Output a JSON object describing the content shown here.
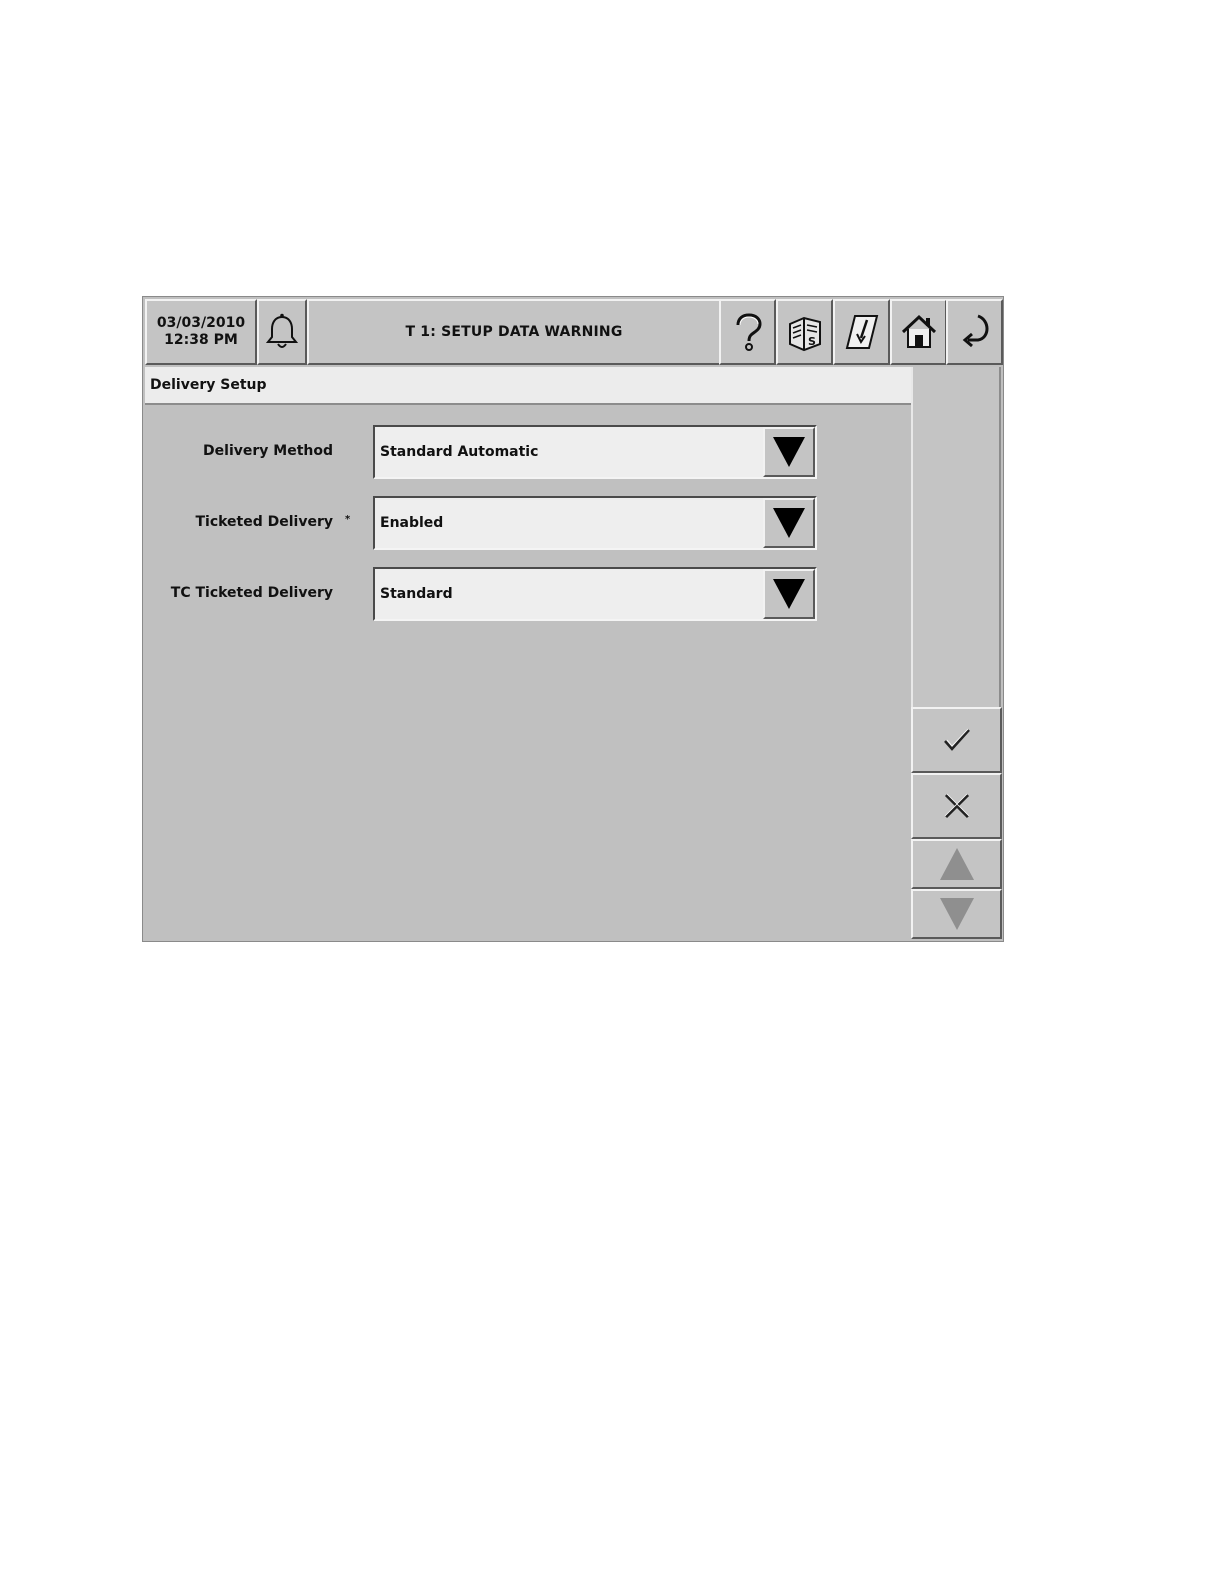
{
  "header": {
    "date": "03/03/2010",
    "time": "12:38 PM",
    "title": "T 1: SETUP DATA WARNING"
  },
  "toolbar_icons": [
    "bell-icon",
    "help-icon",
    "manual-icon",
    "ticket-icon",
    "home-icon",
    "back-icon"
  ],
  "section": {
    "title": "Delivery Setup"
  },
  "fields": [
    {
      "label": "Delivery Method",
      "value": "Standard Automatic",
      "marker": ""
    },
    {
      "label": "Ticketed Delivery",
      "value": "Enabled",
      "marker": "*"
    },
    {
      "label": "TC Ticketed Delivery",
      "value": "Standard",
      "marker": ""
    }
  ],
  "side_icons": [
    "check-icon",
    "close-icon",
    "scroll-up-icon",
    "scroll-down-icon"
  ],
  "colors": {
    "background": "#c0c0c0",
    "header_strip": "#ececec",
    "input_fill": "#eeeeee"
  }
}
